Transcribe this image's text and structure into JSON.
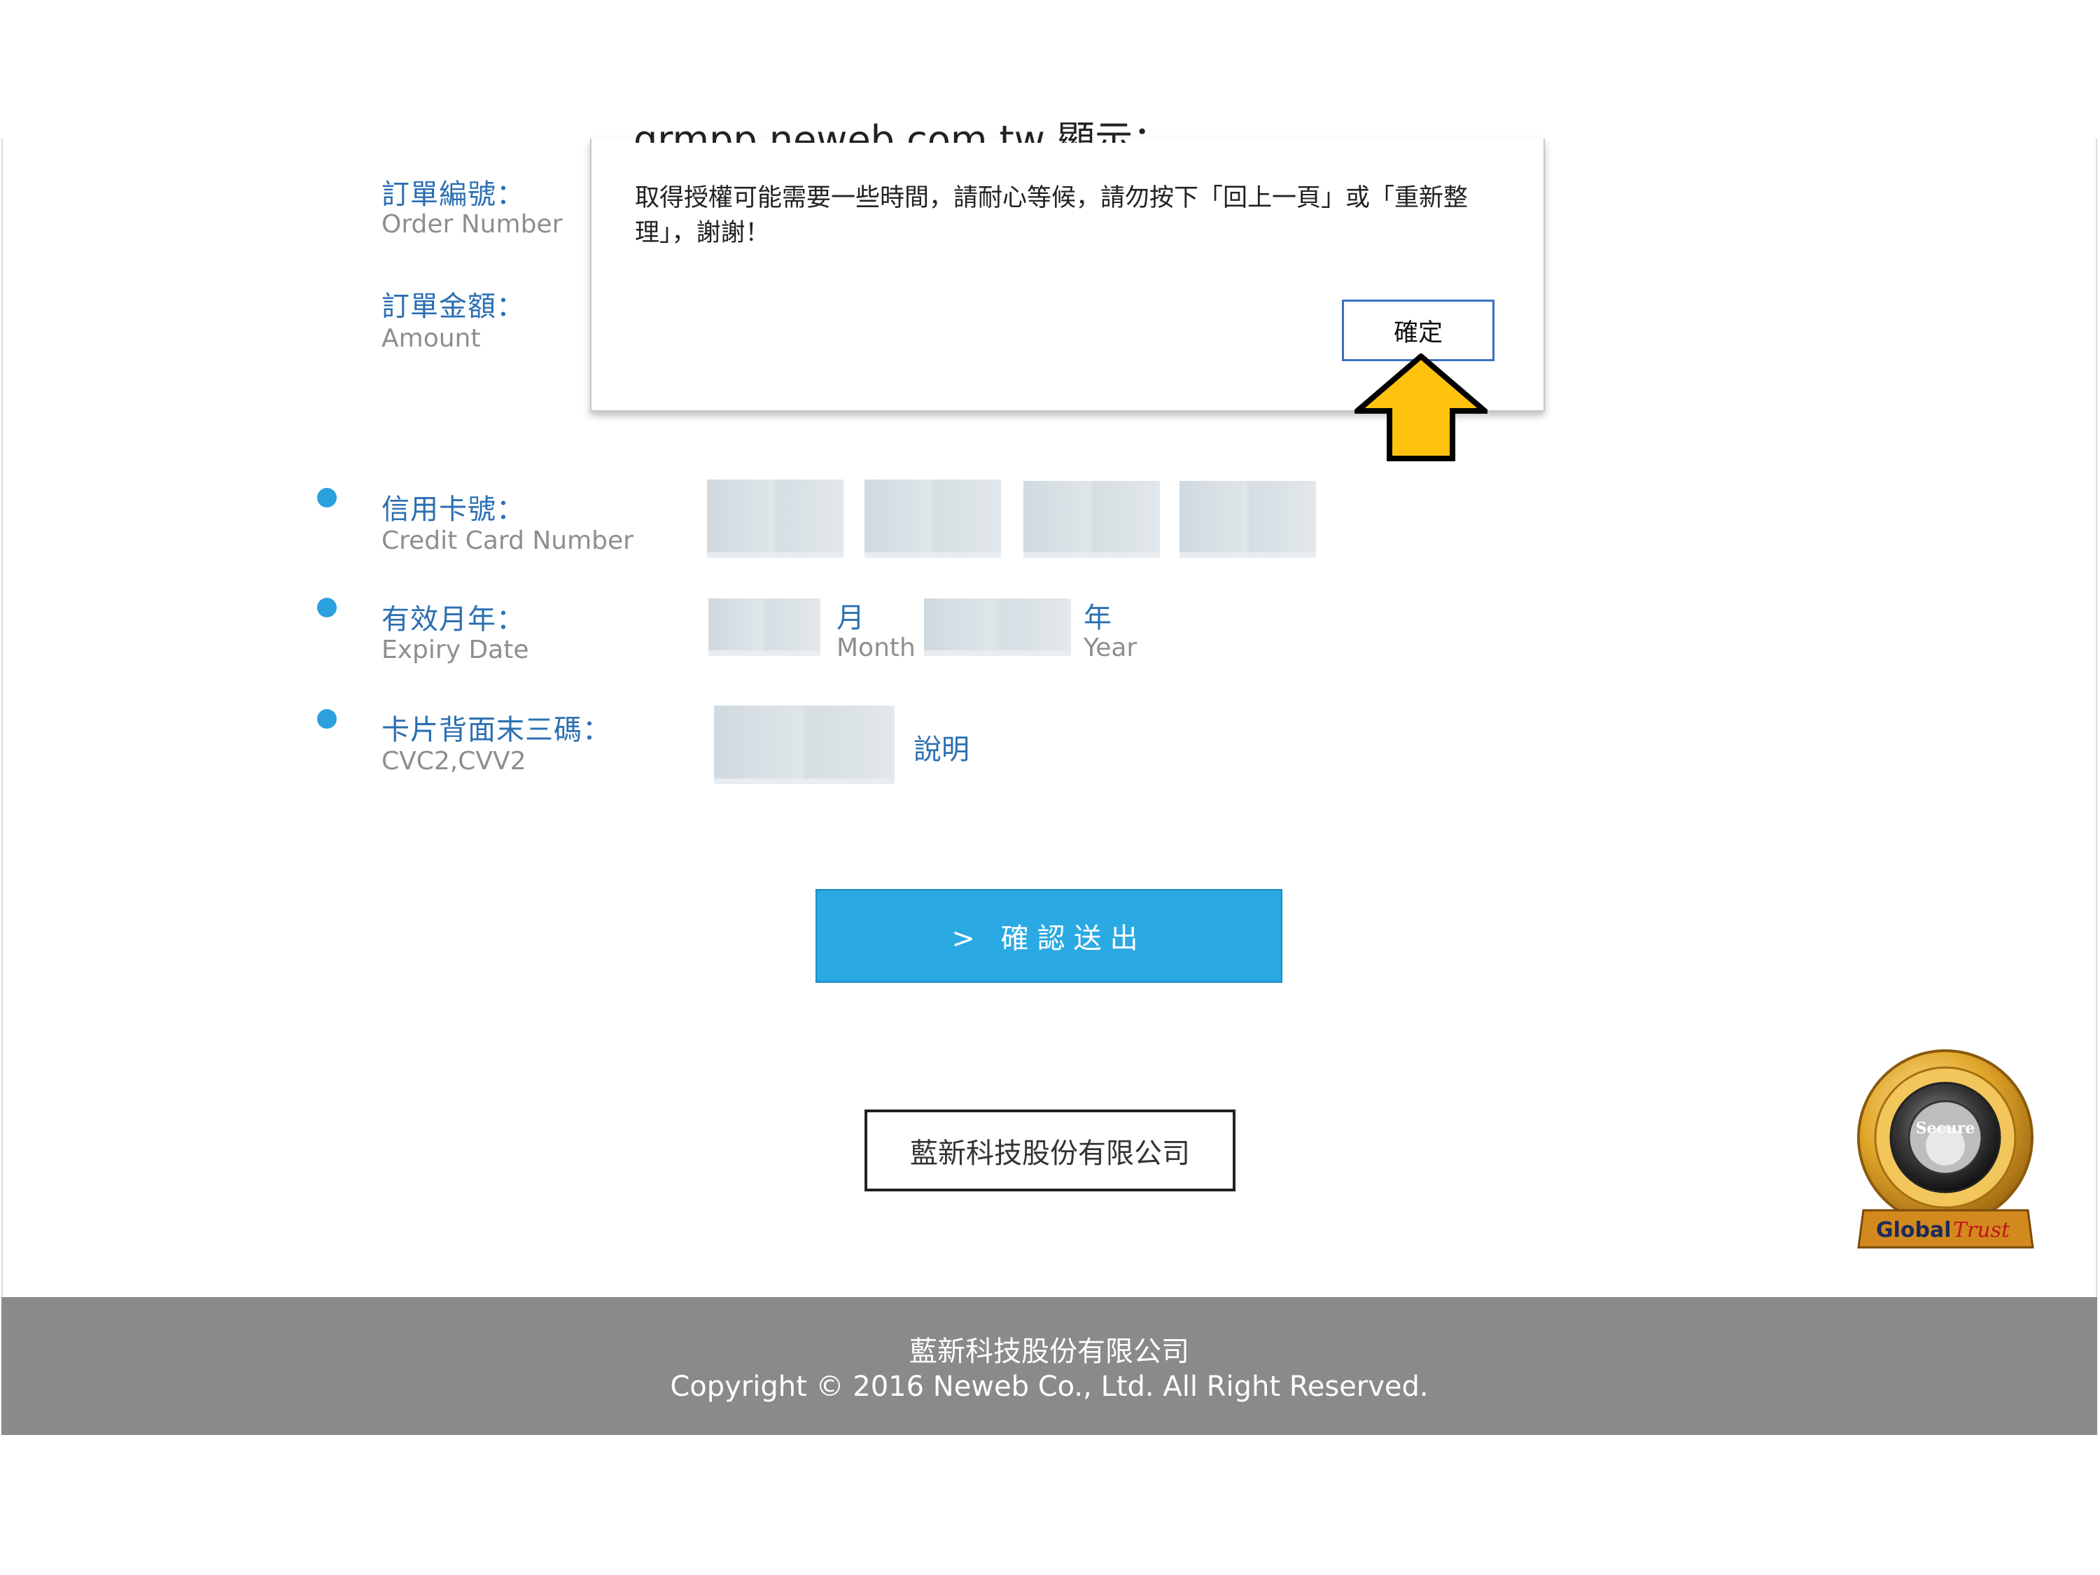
{
  "dialog": {
    "host": "qrmpp.neweb.com.tw 顯示：",
    "message": "取得授權可能需要一些時間，請耐心等候，請勿按下「回上一頁」或「重新整理」，謝謝！",
    "ok_label": "確定"
  },
  "order": {
    "number_zh": "訂單編號：",
    "number_en": "Order Number",
    "amount_zh": "訂單金額：",
    "amount_en": "Amount"
  },
  "card": {
    "number_zh": "信用卡號：",
    "number_en": "Credit Card Number",
    "expiry_zh": "有效月年：",
    "expiry_en": "Expiry Date",
    "month_zh": "月",
    "month_en": "Month",
    "year_zh": "年",
    "year_en": "Year",
    "cvc_zh": "卡片背面末三碼：",
    "cvc_en": "CVC2,CVV2",
    "help_label": "說明"
  },
  "submit_label": "> 確認送出",
  "company_name": "藍新科技股份有限公司",
  "footer": {
    "company": "藍新科技股份有限公司",
    "copyright": "Copyright © 2016 Neweb Co., Ltd. All Right Reserved."
  },
  "badge": {
    "icon": "global-trust-secure-seal-icon",
    "center_text": "Secure",
    "brand_left": "Global",
    "brand_right": "Trust"
  },
  "colors": {
    "accent": "#2aa9e3",
    "label_blue": "#2b6fb3",
    "footer_gray": "#8a8a8a",
    "arrow_yellow": "#ffc20e"
  }
}
